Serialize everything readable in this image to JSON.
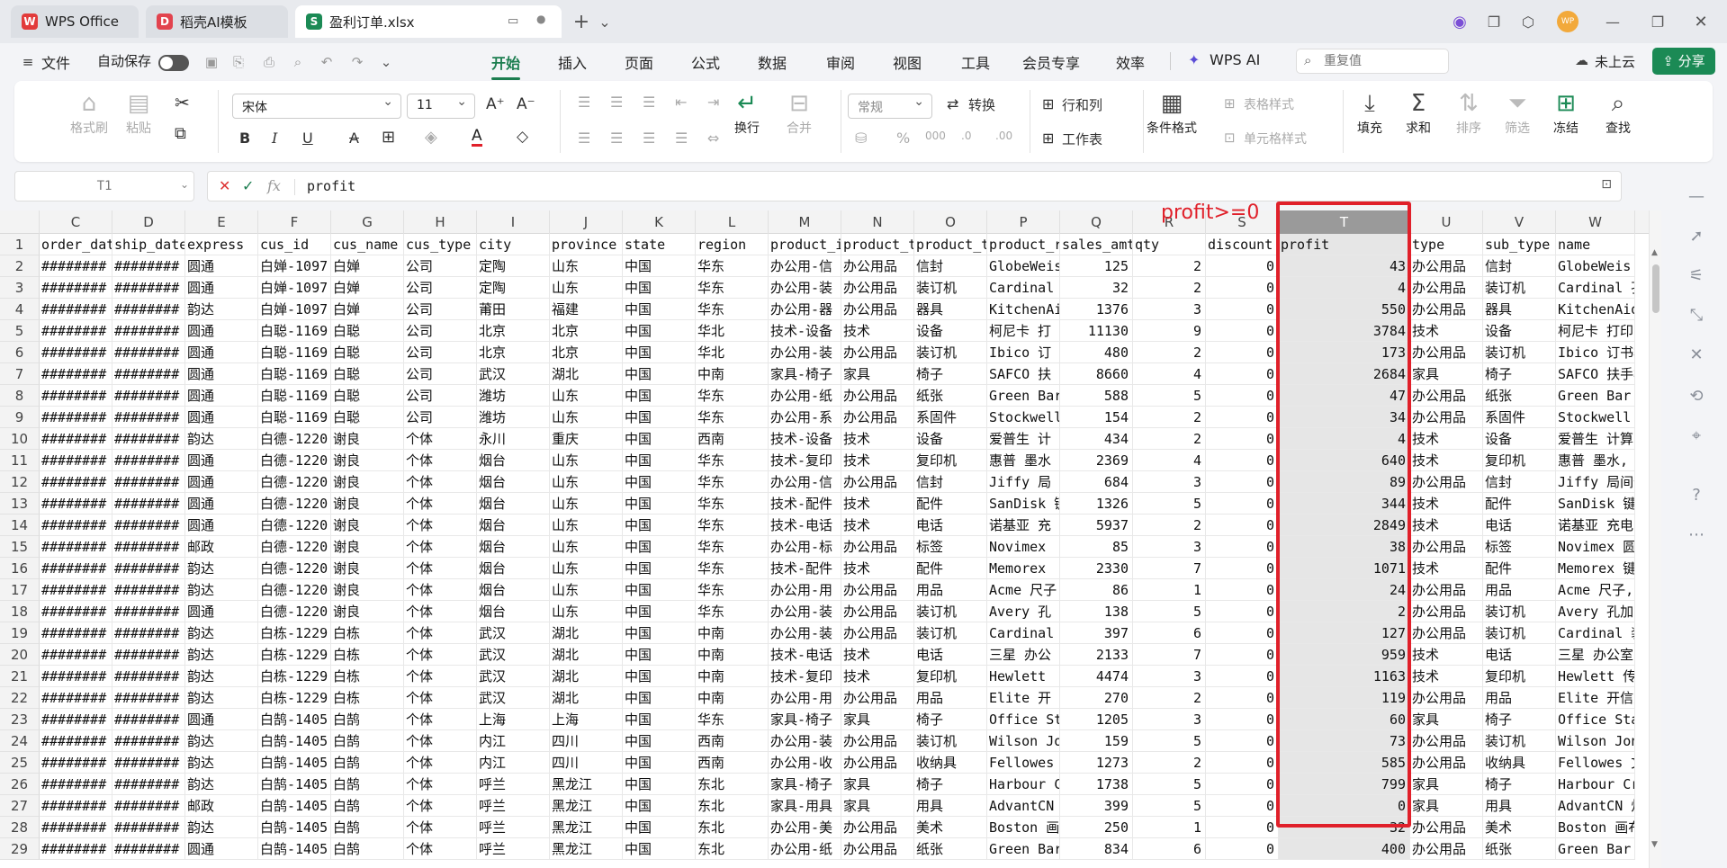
{
  "tabs": [
    {
      "label": "WPS Office",
      "icon": "wps-logo-icon"
    },
    {
      "label": "稻壳AI模板",
      "icon": "docer-icon"
    },
    {
      "label": "盈利订单.xlsx",
      "icon": "spreadsheet-icon",
      "active": true
    }
  ],
  "menu": {
    "file": "文件",
    "autosave": "自动保存",
    "items": [
      "开始",
      "插入",
      "页面",
      "公式",
      "数据",
      "审阅",
      "视图",
      "工具",
      "会员专享",
      "效率"
    ],
    "active": "开始",
    "wps_ai": "WPS AI",
    "search_placeholder": "重复值",
    "cloud": "未上云",
    "share": "分享"
  },
  "ribbon": {
    "format_painter": "格式刷",
    "paste": "粘贴",
    "font": "宋体",
    "font_size": "11",
    "wrap": "换行",
    "merge": "合并",
    "number_format": "常规",
    "convert": "转换",
    "row_col": "行和列",
    "worksheet": "工作表",
    "cond_format": "条件格式",
    "table_style": "表格样式",
    "cell_style": "单元格样式",
    "fill": "填充",
    "sum": "求和",
    "sort": "排序",
    "filter": "筛选",
    "freeze": "冻结",
    "find": "查找"
  },
  "formula_bar": {
    "name_box": "T1",
    "value": "profit"
  },
  "annotation": "profit>=0",
  "columns": [
    "C",
    "D",
    "E",
    "F",
    "G",
    "H",
    "I",
    "J",
    "K",
    "L",
    "M",
    "N",
    "O",
    "P",
    "Q",
    "R",
    "S",
    "T",
    "U",
    "V",
    "W"
  ],
  "selected_column": "T",
  "header_row": [
    "order_dat",
    "ship_date",
    "express",
    "cus_id",
    "cus_name",
    "cus_type",
    "city",
    "province",
    "state",
    "region",
    "product_i",
    "product_t",
    "product_t",
    "product_r",
    "sales_amt",
    "qty",
    "discount",
    "profit",
    "type",
    "sub_type",
    "name"
  ],
  "rows": [
    [
      "########",
      "########",
      "圆通",
      "白婵-1097",
      "白婵",
      "公司",
      "定陶",
      "山东",
      "中国",
      "华东",
      "办公用-信",
      "办公用品",
      "信封",
      "GlobeWeis",
      "125",
      "2",
      "0",
      "43",
      "办公用品",
      "信封",
      "GlobeWeis 扌"
    ],
    [
      "########",
      "########",
      "圆通",
      "白婵-1097",
      "白婵",
      "公司",
      "定陶",
      "山东",
      "中国",
      "华东",
      "办公用-装",
      "办公用品",
      "装订机",
      "Cardinal",
      "32",
      "2",
      "0",
      "4",
      "办公用品",
      "装订机",
      "Cardinal 孔"
    ],
    [
      "########",
      "########",
      "韵达",
      "白婵-1097",
      "白婵",
      "公司",
      "莆田",
      "福建",
      "中国",
      "华东",
      "办公用-器",
      "办公用品",
      "器具",
      "KitchenAi",
      "1376",
      "3",
      "0",
      "550",
      "办公用品",
      "器具",
      "KitchenAid"
    ],
    [
      "########",
      "########",
      "圆通",
      "白聪-1169",
      "白聪",
      "公司",
      "北京",
      "北京",
      "中国",
      "华北",
      "技术-设备",
      "技术",
      "设备",
      "柯尼卡 打",
      "11130",
      "9",
      "0",
      "3784",
      "技术",
      "设备",
      "柯尼卡 打印"
    ],
    [
      "########",
      "########",
      "圆通",
      "白聪-1169",
      "白聪",
      "公司",
      "北京",
      "北京",
      "中国",
      "华北",
      "办公用-装",
      "办公用品",
      "装订机",
      "Ibico 订",
      "480",
      "2",
      "0",
      "173",
      "办公用品",
      "装订机",
      "Ibico 订书机"
    ],
    [
      "########",
      "########",
      "圆通",
      "白聪-1169",
      "白聪",
      "公司",
      "武汉",
      "湖北",
      "中国",
      "中南",
      "家具-椅子",
      "家具",
      "椅子",
      "SAFCO 扶",
      "8660",
      "4",
      "0",
      "2684",
      "家具",
      "椅子",
      "SAFCO 扶手椅"
    ],
    [
      "########",
      "########",
      "圆通",
      "白聪-1169",
      "白聪",
      "公司",
      "潍坊",
      "山东",
      "中国",
      "华东",
      "办公用-纸",
      "办公用品",
      "纸张",
      "Green Bar",
      "588",
      "5",
      "0",
      "47",
      "办公用品",
      "纸张",
      "Green Bar 计"
    ],
    [
      "########",
      "########",
      "圆通",
      "白聪-1169",
      "白聪",
      "公司",
      "潍坊",
      "山东",
      "中国",
      "华东",
      "办公用-系",
      "办公用品",
      "系固件",
      "Stockwell",
      "154",
      "2",
      "0",
      "34",
      "办公用品",
      "系固件",
      "Stockwell 橡"
    ],
    [
      "########",
      "########",
      "韵达",
      "白德-1220",
      "谢良",
      "个体",
      "永川",
      "重庆",
      "中国",
      "西南",
      "技术-设备",
      "技术",
      "设备",
      "爱普生 计",
      "434",
      "2",
      "0",
      "4",
      "技术",
      "设备",
      "爱普生 计算"
    ],
    [
      "########",
      "########",
      "圆通",
      "白德-1220",
      "谢良",
      "个体",
      "烟台",
      "山东",
      "中国",
      "华东",
      "技术-复印",
      "技术",
      "复印机",
      "惠普 墨水",
      "2369",
      "4",
      "0",
      "640",
      "技术",
      "复印机",
      "惠普 墨水,"
    ],
    [
      "########",
      "########",
      "圆通",
      "白德-1220",
      "谢良",
      "个体",
      "烟台",
      "山东",
      "中国",
      "华东",
      "办公用-信",
      "办公用品",
      "信封",
      "Jiffy 局",
      "684",
      "3",
      "0",
      "89",
      "办公用品",
      "信封",
      "Jiffy 局间信"
    ],
    [
      "########",
      "########",
      "圆通",
      "白德-1220",
      "谢良",
      "个体",
      "烟台",
      "山东",
      "中国",
      "华东",
      "技术-配件",
      "技术",
      "配件",
      "SanDisk 键",
      "1326",
      "5",
      "0",
      "344",
      "技术",
      "配件",
      "SanDisk 键区"
    ],
    [
      "########",
      "########",
      "圆通",
      "白德-1220",
      "谢良",
      "个体",
      "烟台",
      "山东",
      "中国",
      "华东",
      "技术-电话",
      "技术",
      "电话",
      "诺基亚 充",
      "5937",
      "2",
      "0",
      "2849",
      "技术",
      "电话",
      "诺基亚 充电"
    ],
    [
      "########",
      "########",
      "邮政",
      "白德-1220",
      "谢良",
      "个体",
      "烟台",
      "山东",
      "中国",
      "华东",
      "办公用-标",
      "办公用品",
      "标签",
      "Novimex",
      "85",
      "3",
      "0",
      "38",
      "办公用品",
      "标签",
      "Novimex 圆形"
    ],
    [
      "########",
      "########",
      "韵达",
      "白德-1220",
      "谢良",
      "个体",
      "烟台",
      "山东",
      "中国",
      "华东",
      "技术-配件",
      "技术",
      "配件",
      "Memorex",
      "2330",
      "7",
      "0",
      "1071",
      "技术",
      "配件",
      "Memorex 键盘"
    ],
    [
      "########",
      "########",
      "韵达",
      "白德-1220",
      "谢良",
      "个体",
      "烟台",
      "山东",
      "中国",
      "华东",
      "办公用-用",
      "办公用品",
      "用品",
      "Acme 尺子",
      "86",
      "1",
      "0",
      "24",
      "办公用品",
      "用品",
      "Acme 尺子,"
    ],
    [
      "########",
      "########",
      "圆通",
      "白德-1220",
      "谢良",
      "个体",
      "烟台",
      "山东",
      "中国",
      "华东",
      "办公用-装",
      "办公用品",
      "装订机",
      "Avery 孔",
      "138",
      "5",
      "0",
      "2",
      "办公用品",
      "装订机",
      "Avery 孔加固"
    ],
    [
      "########",
      "########",
      "韵达",
      "白栋-1229",
      "白栋",
      "个体",
      "武汉",
      "湖北",
      "中国",
      "中南",
      "办公用-装",
      "办公用品",
      "装订机",
      "Cardinal",
      "397",
      "6",
      "0",
      "127",
      "办公用品",
      "装订机",
      "Cardinal 装"
    ],
    [
      "########",
      "########",
      "韵达",
      "白栋-1229",
      "白栋",
      "个体",
      "武汉",
      "湖北",
      "中国",
      "中南",
      "技术-电话",
      "技术",
      "电话",
      "三星 办公",
      "2133",
      "7",
      "0",
      "959",
      "技术",
      "电话",
      "三星 办公室"
    ],
    [
      "########",
      "########",
      "韵达",
      "白栋-1229",
      "白栋",
      "个体",
      "武汉",
      "湖北",
      "中国",
      "中南",
      "技术-复印",
      "技术",
      "复印机",
      "Hewlett",
      "4474",
      "3",
      "0",
      "1163",
      "技术",
      "复印机",
      "Hewlett 传真"
    ],
    [
      "########",
      "########",
      "韵达",
      "白栋-1229",
      "白栋",
      "个体",
      "武汉",
      "湖北",
      "中国",
      "中南",
      "办公用-用",
      "办公用品",
      "用品",
      "Elite 开",
      "270",
      "2",
      "0",
      "119",
      "办公用品",
      "用品",
      "Elite 开信刀"
    ],
    [
      "########",
      "########",
      "圆通",
      "白鹄-1405",
      "白鹄",
      "个体",
      "上海",
      "上海",
      "中国",
      "华东",
      "家具-椅子",
      "家具",
      "椅子",
      "Office St",
      "1205",
      "3",
      "0",
      "60",
      "家具",
      "椅子",
      "Office Star"
    ],
    [
      "########",
      "########",
      "韵达",
      "白鹄-1405",
      "白鹄",
      "个体",
      "内江",
      "四川",
      "中国",
      "西南",
      "办公用-装",
      "办公用品",
      "装订机",
      "Wilson Jo",
      "159",
      "5",
      "0",
      "73",
      "办公用品",
      "装订机",
      "Wilson Jone"
    ],
    [
      "########",
      "########",
      "韵达",
      "白鹄-1405",
      "白鹄",
      "个体",
      "内江",
      "四川",
      "中国",
      "西南",
      "办公用-收",
      "办公用品",
      "收纳具",
      "Fellowes",
      "1273",
      "2",
      "0",
      "585",
      "办公用品",
      "收纳具",
      "Fellowes 文"
    ],
    [
      "########",
      "########",
      "韵达",
      "白鹄-1405",
      "白鹄",
      "个体",
      "呼兰",
      "黑龙江",
      "中国",
      "东北",
      "家具-椅子",
      "家具",
      "椅子",
      "Harbour C",
      "1738",
      "5",
      "0",
      "799",
      "家具",
      "椅子",
      "Harbour Cre"
    ],
    [
      "########",
      "########",
      "邮政",
      "白鹄-1405",
      "白鹄",
      "个体",
      "呼兰",
      "黑龙江",
      "中国",
      "东北",
      "家具-用具",
      "家具",
      "用具",
      "AdvantCN",
      "399",
      "5",
      "0",
      "0",
      "家具",
      "用具",
      "AdvantCN 灯"
    ],
    [
      "########",
      "########",
      "韵达",
      "白鹄-1405",
      "白鹄",
      "个体",
      "呼兰",
      "黑龙江",
      "中国",
      "东北",
      "办公用-美",
      "办公用品",
      "美术",
      "Boston 画",
      "250",
      "1",
      "0",
      "32",
      "办公用品",
      "美术",
      "Boston 画布"
    ],
    [
      "########",
      "########",
      "圆通",
      "白鹄-1405",
      "白鹄",
      "个体",
      "呼兰",
      "黑龙江",
      "中国",
      "东北",
      "办公用-纸",
      "办公用品",
      "纸张",
      "Green Bar",
      "834",
      "6",
      "0",
      "400",
      "办公用品",
      "纸张",
      "Green Bar 笔"
    ]
  ]
}
